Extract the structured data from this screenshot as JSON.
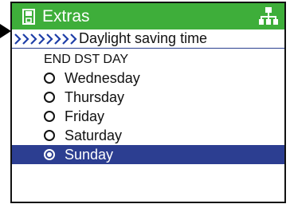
{
  "header": {
    "title": "Extras",
    "left_icon": "save-icon",
    "right_icon": "network-icon",
    "color": "#3eae3a"
  },
  "path": {
    "text": "Daylight saving time",
    "prefix_icon": "chevrons-icon"
  },
  "section": {
    "label": "END DST DAY"
  },
  "options": [
    {
      "label": "Wednesday",
      "selected": false
    },
    {
      "label": "Thursday",
      "selected": false
    },
    {
      "label": "Friday",
      "selected": false
    },
    {
      "label": "Saturday",
      "selected": false
    },
    {
      "label": "Sunday",
      "selected": true
    }
  ],
  "colors": {
    "selection": "#2c3e91",
    "accent_blue": "#2a3f8f"
  }
}
